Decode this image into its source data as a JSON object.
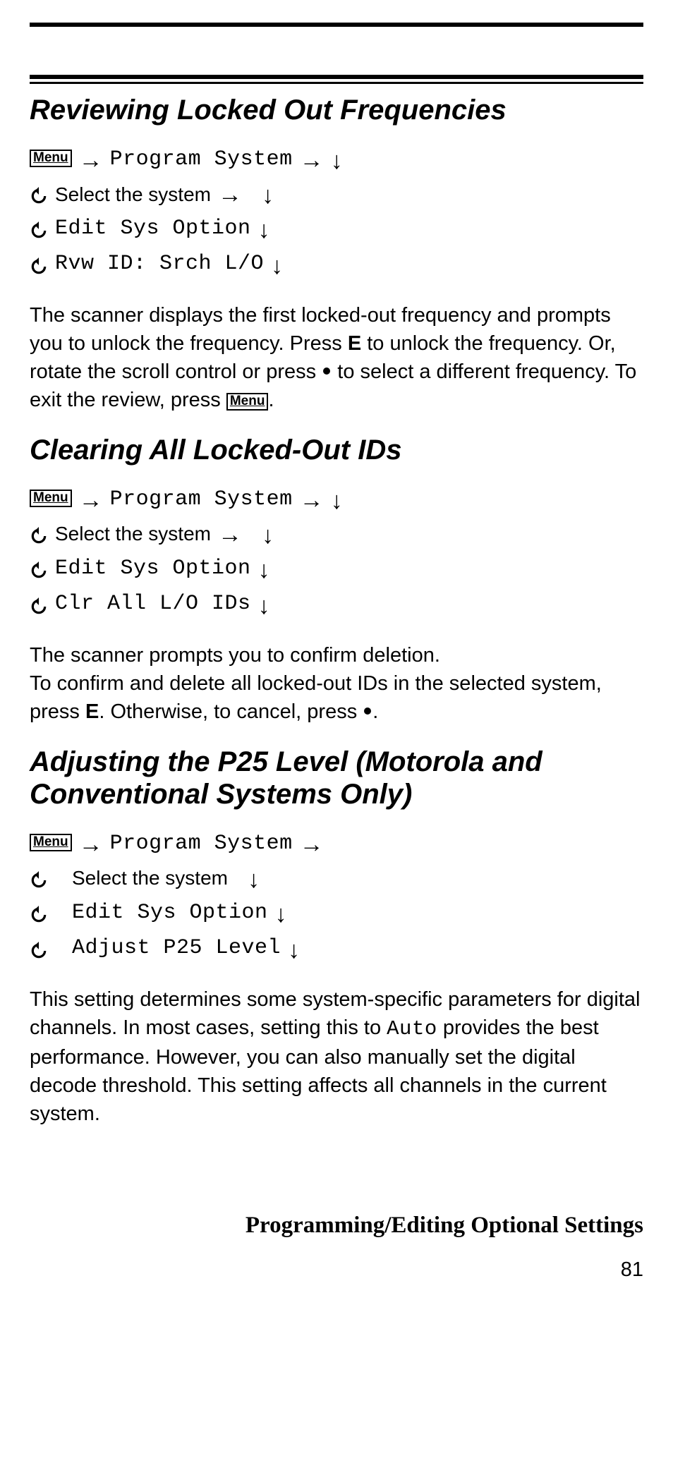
{
  "labels": {
    "menu": "Menu"
  },
  "sections": {
    "s1": {
      "title": "Reviewing Locked Out Frequencies",
      "step_program_system": "Program System",
      "step_select_system": "Select the system",
      "step_edit_sys_option": "Edit Sys Option",
      "step_rvw_id": "Rvw ID: Srch L/O",
      "para_prefix": "The scanner displays the first locked-out frequency and prompts you to unlock the frequency. Press ",
      "para_e": "E",
      "para_mid": " to unlock the frequency. Or, rotate the scroll control or press ",
      "para_after_dot": " to select a different frequency. To exit the review, press ",
      "para_period": "."
    },
    "s2": {
      "title": "Clearing All Locked-Out IDs",
      "step_program_system": "Program System",
      "step_select_system": "Select the system",
      "step_edit_sys_option": "Edit Sys Option",
      "step_clr_ids": "Clr All L/O IDs",
      "para_line1": "The scanner prompts you to confirm deletion.",
      "para_prefix": "To confirm and delete all locked-out IDs in the selected system, press ",
      "para_e": "E",
      "para_mid": ". Otherwise, to cancel, press ",
      "para_period": "."
    },
    "s3": {
      "title": "Adjusting the P25 Level (Motorola and Conventional Systems Only)",
      "step_program_system": "Program System",
      "step_select_system": "Select the system",
      "step_edit_sys_option": "Edit Sys Option",
      "step_adjust_p25": "Adjust P25 Level",
      "para_prefix": "This setting determines some system-specific parameters for digital channels. In most cases, setting this to ",
      "para_auto": "Auto",
      "para_rest": " provides the best performance. However, you can also manually set the digital decode threshold. This setting affects all channels in the current system."
    }
  },
  "footer": {
    "title": "Programming/Editing Optional Settings",
    "page": "81"
  }
}
